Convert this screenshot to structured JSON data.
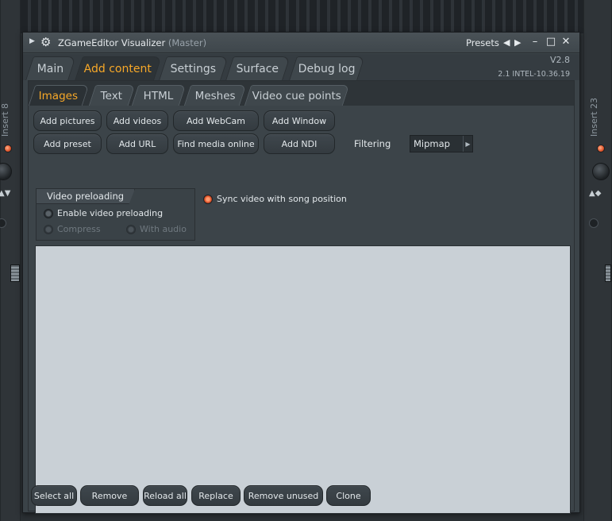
{
  "window": {
    "title": "ZGameEditor Visualizer",
    "subtitle": "(Master)",
    "presets_label": "Presets",
    "version": "V2.8",
    "build": "2.1 INTEL-10.36.19"
  },
  "side": {
    "left_label": "Insert 8",
    "right_label": "Insert 23"
  },
  "tabs": [
    {
      "label": "Main"
    },
    {
      "label": "Add content"
    },
    {
      "label": "Settings"
    },
    {
      "label": "Surface"
    },
    {
      "label": "Debug log"
    }
  ],
  "subtabs": [
    {
      "label": "Images"
    },
    {
      "label": "Text"
    },
    {
      "label": "HTML"
    },
    {
      "label": "Meshes"
    },
    {
      "label": "Video cue points"
    }
  ],
  "buttons": {
    "add_pictures": "Add pictures",
    "add_videos": "Add videos",
    "add_webcam": "Add WebCam",
    "add_window": "Add Window",
    "add_preset": "Add preset",
    "add_url": "Add URL",
    "find_media_online": "Find media online",
    "add_ndi": "Add NDI"
  },
  "filtering": {
    "label": "Filtering",
    "value": "Mipmap"
  },
  "video_preloading": {
    "title": "Video preloading",
    "enable": "Enable video preloading",
    "compress": "Compress",
    "with_audio": "With audio"
  },
  "sync_video": "Sync video with song position",
  "bottom": {
    "select_all": "Select all",
    "remove": "Remove",
    "reload_all": "Reload all",
    "replace": "Replace",
    "remove_unused": "Remove unused",
    "clone": "Clone"
  },
  "colors": {
    "accent": "#f7a828",
    "led": "#e0542a",
    "list_bg": "#c9d0d6"
  }
}
